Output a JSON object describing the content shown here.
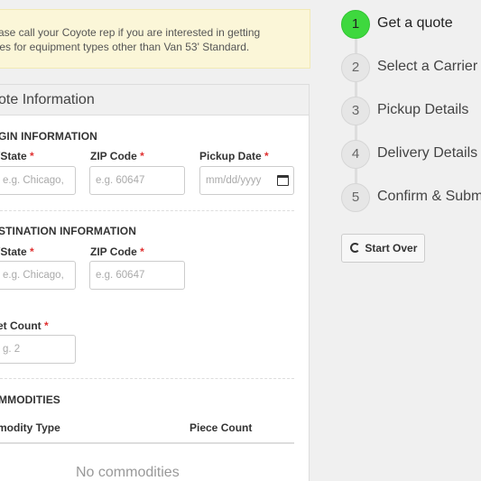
{
  "notice": {
    "line1": "ase call your Coyote rep if you are interested in getting",
    "line2": "tes for equipment types other than Van 53' Standard."
  },
  "panel": {
    "title": "ote Information",
    "origin": {
      "section_title": "GIN INFORMATION",
      "city_label": "/State",
      "city_placeholder": "e.g. Chicago,",
      "zip_label": "ZIP Code",
      "zip_placeholder": "e.g. 60647",
      "date_label": "Pickup Date",
      "date_placeholder": "mm/dd/yyyy"
    },
    "destination": {
      "section_title": "STINATION INFORMATION",
      "city_label": "/State",
      "city_placeholder": "e.g. Chicago,",
      "zip_label": "ZIP Code",
      "zip_placeholder": "e.g. 60647"
    },
    "pallet": {
      "label": "et Count",
      "placeholder": "g. 2"
    },
    "commodities": {
      "section_title": "MMODITIES",
      "col_type": "modity Type",
      "col_count": "Piece Count",
      "empty_text": "No commodities"
    },
    "required_mark": "*"
  },
  "steps": [
    {
      "number": "1",
      "label": "Get a quote",
      "active": true
    },
    {
      "number": "2",
      "label": "Select a Carrier",
      "active": false
    },
    {
      "number": "3",
      "label": "Pickup Details",
      "active": false
    },
    {
      "number": "4",
      "label": "Delivery Details",
      "active": false
    },
    {
      "number": "5",
      "label": "Confirm & Subm",
      "active": false
    }
  ],
  "start_over_label": "Start Over",
  "colors": {
    "active_step": "#3ed83e",
    "notice_bg": "#fbf6d8",
    "required": "#e03030"
  }
}
